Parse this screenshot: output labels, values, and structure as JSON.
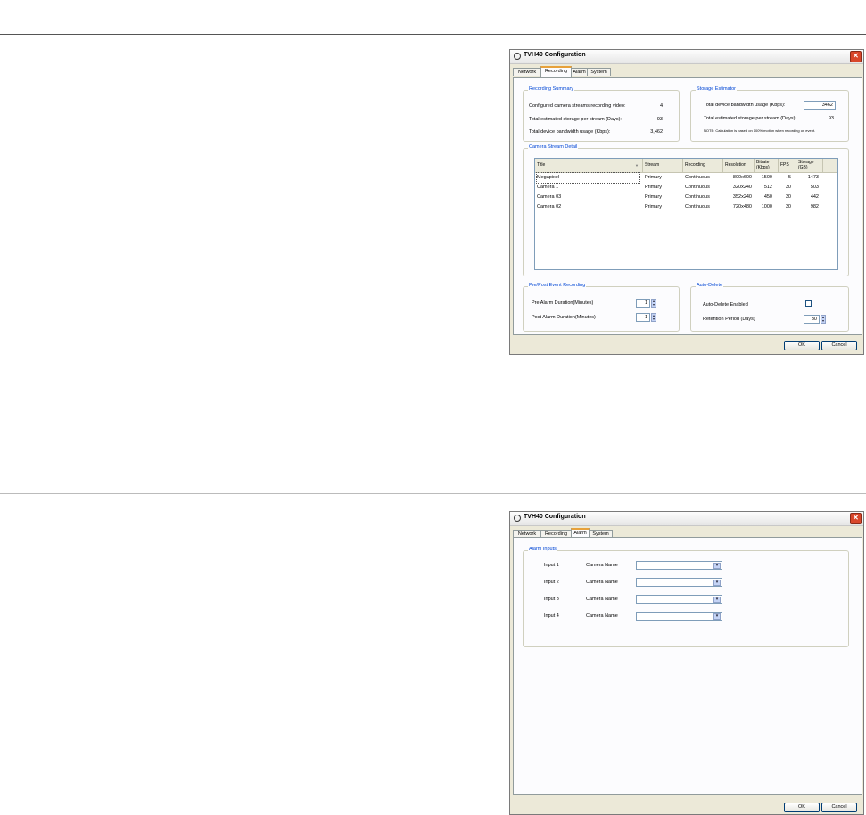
{
  "window_title": "TVH40 Configuration",
  "tabs": [
    "Network",
    "Recording",
    "Alarm",
    "System"
  ],
  "close_glyph": "✕",
  "buttons": {
    "ok": "OK",
    "cancel": "Cancel"
  },
  "recording": {
    "summary": {
      "title": "Recording Summary",
      "rows": [
        {
          "label": "Configured camera streams recording video:",
          "value": "4"
        },
        {
          "label": "Total estimated storage per stream (Days):",
          "value": "93"
        },
        {
          "label": "Total device bandwidth usage (Kbps):",
          "value": "3,462"
        }
      ]
    },
    "estimator": {
      "title": "Storage Estimator",
      "bandwidth_label": "Total device bandwidth usage (Kbps):",
      "bandwidth_value": "3462",
      "storage_label": "Total estimated storage per stream (Days):",
      "storage_value": "93",
      "note": "NOTE:  Calculation is based on 100% motion when recording on event."
    },
    "detail": {
      "title": "Camera Stream Detail",
      "columns": [
        "Title",
        "Stream",
        "Recording",
        "Resolution",
        "Bitrate (Kbps)",
        "FPS",
        "Storage (GB)"
      ],
      "rows": [
        [
          "Megapixel",
          "Primary",
          "Continuous",
          "800x600",
          "1500",
          "5",
          "1473"
        ],
        [
          "Camera 1",
          "Primary",
          "Continuous",
          "320x240",
          "512",
          "30",
          "503"
        ],
        [
          "Camera 03",
          "Primary",
          "Continuous",
          "352x240",
          "450",
          "30",
          "442"
        ],
        [
          "Camera 02",
          "Primary",
          "Continuous",
          "720x480",
          "1000",
          "30",
          "982"
        ]
      ]
    },
    "prepost": {
      "title": "Pre/Post Event Recording",
      "pre_label": "Pre Alarm Duration(Minutes)",
      "pre_value": "1",
      "post_label": "Post Alarm Duration(Minutes)",
      "post_value": "1"
    },
    "autodelete": {
      "title": "Auto-Delete",
      "enabled_label": "Auto-Delete Enabled",
      "retention_label": "Retention Period (Days)",
      "retention_value": "30"
    }
  },
  "alarm": {
    "title": "Alarm Inputs",
    "inputs": [
      {
        "label": "Input 1",
        "camera_label": "Camera Name",
        "value": ""
      },
      {
        "label": "Input 2",
        "camera_label": "Camera Name",
        "value": ""
      },
      {
        "label": "Input 3",
        "camera_label": "Camera Name",
        "value": ""
      },
      {
        "label": "Input 4",
        "camera_label": "Camera Name",
        "value": ""
      }
    ]
  }
}
